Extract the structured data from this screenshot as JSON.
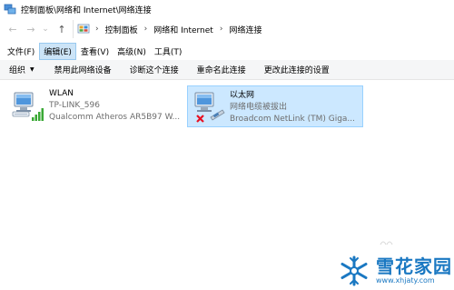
{
  "window": {
    "title": "控制面板\\网络和 Internet\\网络连接",
    "icon": "network-connections-icon"
  },
  "address": {
    "back_icon": "←",
    "forward_icon": "→",
    "dropdown_icon": "⌄",
    "up_icon": "↑",
    "separator": "›",
    "crumbs": [
      "控制面板",
      "网络和 Internet",
      "网络连接"
    ]
  },
  "menu": {
    "items": [
      {
        "label": "文件(F)",
        "active": false
      },
      {
        "label": "编辑(E)",
        "active": true
      },
      {
        "label": "查看(V)",
        "active": false
      },
      {
        "label": "高级(N)",
        "active": false
      },
      {
        "label": "工具(T)",
        "active": false
      }
    ]
  },
  "commands": {
    "organize": "组织",
    "organize_caret": "▼",
    "disable": "禁用此网络设备",
    "diagnose": "诊断这个连接",
    "rename": "重命名此连接",
    "change_settings": "更改此连接的设置"
  },
  "adapters": [
    {
      "name": "WLAN",
      "status": "TP-LINK_596",
      "device": "Qualcomm Atheros AR5B97 W...",
      "selected": false,
      "icon": "wireless-adapter-icon"
    },
    {
      "name": "以太网",
      "status": "网络电缆被拔出",
      "device": "Broadcom NetLink (TM) Giga...",
      "selected": true,
      "icon": "ethernet-adapter-icon"
    }
  ],
  "colors": {
    "selection_bg": "#cce8ff",
    "selection_border": "#99d1ff",
    "menu_active_bg": "#cce4f7",
    "signal_green": "#3aa935",
    "error_red": "#e81123",
    "watermark_blue": "#1a78c2"
  },
  "watermark": {
    "title": "雪花家园",
    "url": "www.xhjaty.com"
  }
}
